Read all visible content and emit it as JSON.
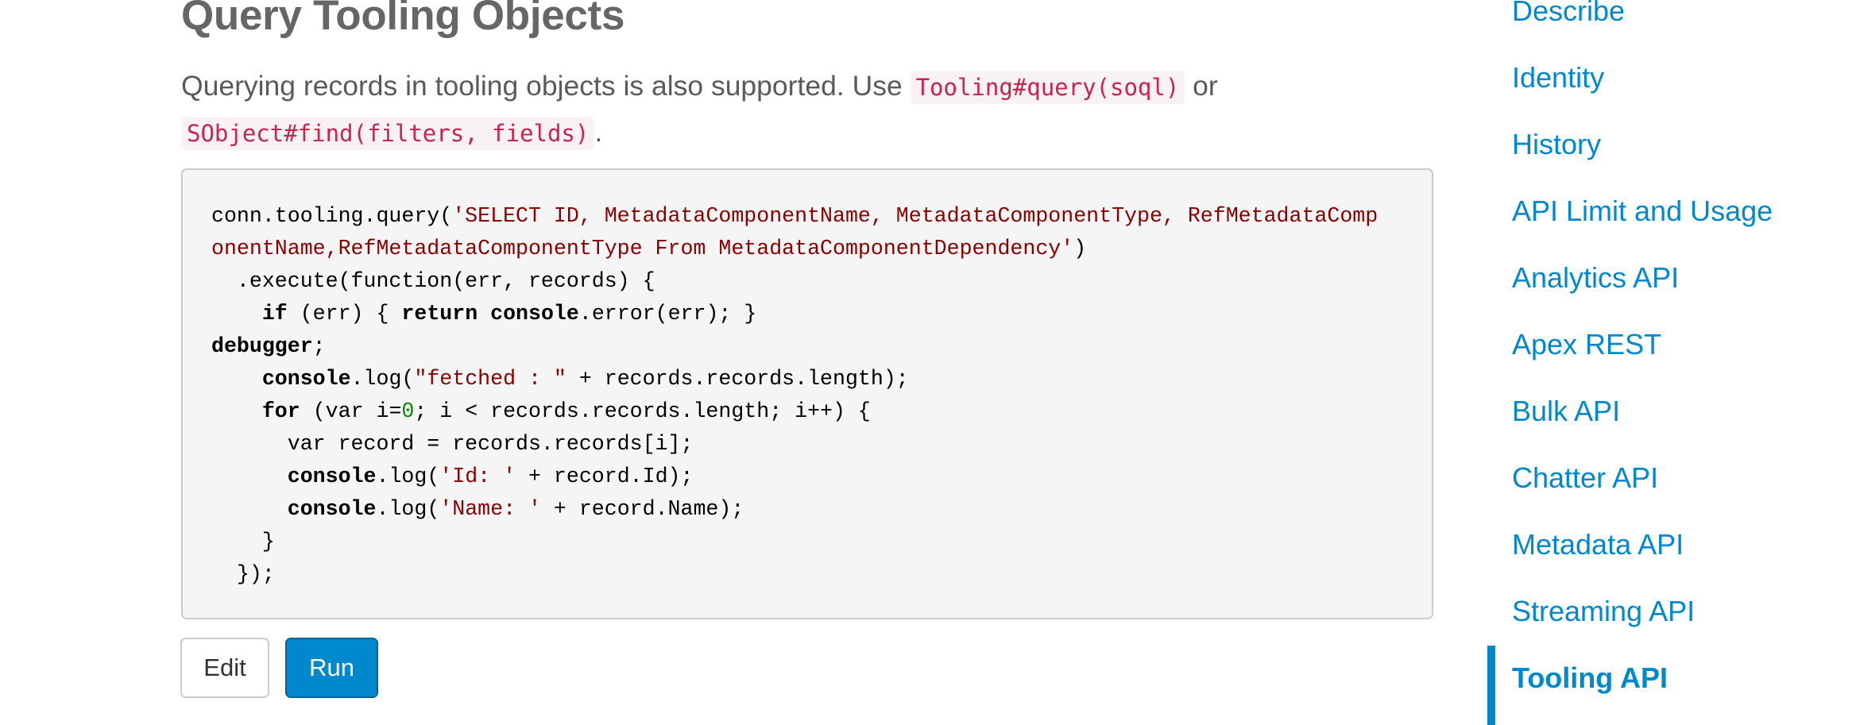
{
  "main": {
    "title": "Query Tooling Objects",
    "intro": {
      "text_before": "Querying records in tooling objects is also supported. Use ",
      "code1": "Tooling#query(soql)",
      "text_between": " or ",
      "code2": "SObject#find(filters, fields)",
      "text_after": "."
    },
    "code": {
      "lines": [
        [
          {
            "t": "conn.tooling.query(",
            "c": ""
          },
          {
            "t": "'SELECT ID, MetadataComponentName, MetadataComponentType, RefMetadataComp",
            "c": "str"
          }
        ],
        [
          {
            "t": "onentName,RefMetadataComponentType From MetadataComponentDependency'",
            "c": "str"
          },
          {
            "t": ")",
            "c": ""
          }
        ],
        [
          {
            "t": "  .execute(function(err, records) {",
            "c": ""
          }
        ],
        [
          {
            "t": "    ",
            "c": ""
          },
          {
            "t": "if",
            "c": "kw"
          },
          {
            "t": " (err) { ",
            "c": ""
          },
          {
            "t": "return",
            "c": "kw"
          },
          {
            "t": " ",
            "c": ""
          },
          {
            "t": "console",
            "c": "kw"
          },
          {
            "t": ".error(err); }",
            "c": ""
          }
        ],
        [
          {
            "t": "debugger",
            "c": "kw"
          },
          {
            "t": ";",
            "c": ""
          }
        ],
        [
          {
            "t": "    ",
            "c": ""
          },
          {
            "t": "console",
            "c": "kw"
          },
          {
            "t": ".log(",
            "c": ""
          },
          {
            "t": "\"fetched : \"",
            "c": "str"
          },
          {
            "t": " + records.records.length);",
            "c": ""
          }
        ],
        [
          {
            "t": "    ",
            "c": ""
          },
          {
            "t": "for",
            "c": "kw"
          },
          {
            "t": " (var i=",
            "c": ""
          },
          {
            "t": "0",
            "c": "num"
          },
          {
            "t": "; i < records.records.length; i++) {",
            "c": ""
          }
        ],
        [
          {
            "t": "      var record = records.records[i];",
            "c": ""
          }
        ],
        [
          {
            "t": "      ",
            "c": ""
          },
          {
            "t": "console",
            "c": "kw"
          },
          {
            "t": ".log(",
            "c": ""
          },
          {
            "t": "'Id: '",
            "c": "str"
          },
          {
            "t": " + record.Id);",
            "c": ""
          }
        ],
        [
          {
            "t": "      ",
            "c": ""
          },
          {
            "t": "console",
            "c": "kw"
          },
          {
            "t": ".log(",
            "c": ""
          },
          {
            "t": "'Name: '",
            "c": "str"
          },
          {
            "t": " + record.Name);",
            "c": ""
          }
        ],
        [
          {
            "t": "    }",
            "c": ""
          }
        ],
        [
          {
            "t": "  });",
            "c": ""
          }
        ]
      ]
    },
    "buttons": {
      "edit_label": "Edit",
      "run_label": "Run"
    }
  },
  "sidebar": {
    "items": [
      {
        "label": "Describe",
        "active": false
      },
      {
        "label": "Identity",
        "active": false
      },
      {
        "label": "History",
        "active": false
      },
      {
        "label": "API Limit and Usage",
        "active": false
      },
      {
        "label": "Analytics API",
        "active": false
      },
      {
        "label": "Apex REST",
        "active": false
      },
      {
        "label": "Bulk API",
        "active": false
      },
      {
        "label": "Chatter API",
        "active": false
      },
      {
        "label": "Metadata API",
        "active": false
      },
      {
        "label": "Streaming API",
        "active": false
      },
      {
        "label": "Tooling API",
        "active": true
      }
    ]
  },
  "colors": {
    "link": "#0088cc",
    "heading": "#666666",
    "inline_code": "#c7254e",
    "string_token": "#880000",
    "number_token": "#008800",
    "run_button": "#0088cc"
  }
}
